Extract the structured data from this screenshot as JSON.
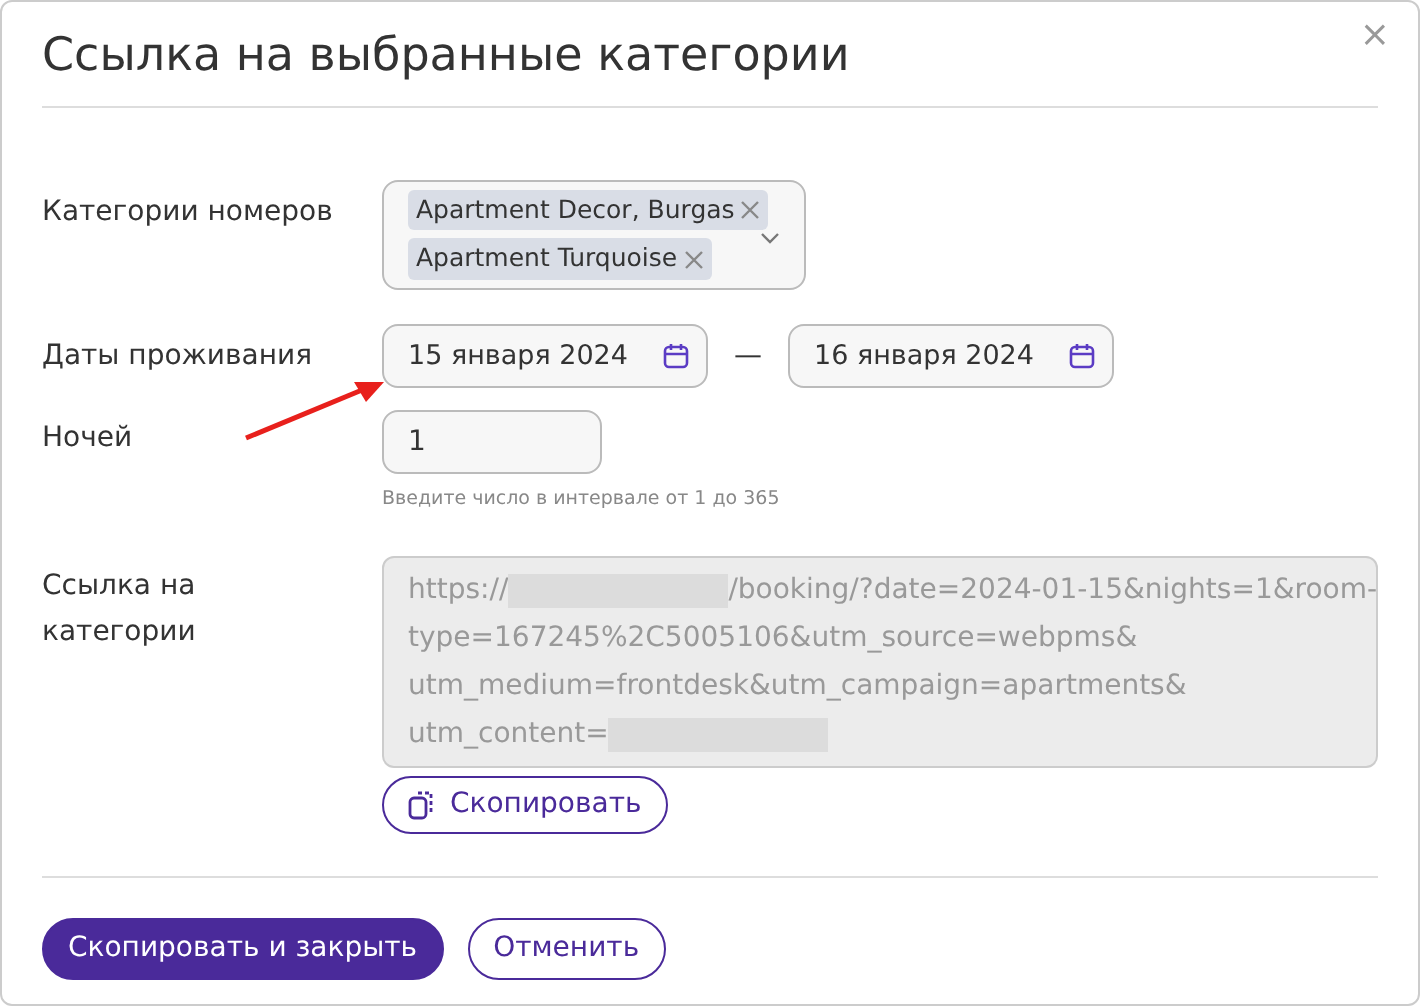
{
  "dialog": {
    "title": "Ссылка на выбранные категории",
    "close": "×"
  },
  "categories": {
    "label": "Категории номеров",
    "tags": [
      {
        "text": "Apartment Decor, Burgas"
      },
      {
        "text": "Apartment Turquoise"
      }
    ]
  },
  "dates": {
    "label": "Даты проживания",
    "from": "15 января 2024",
    "separator": "—",
    "to": "16 января 2024"
  },
  "nights": {
    "label": "Ночей",
    "value": "1",
    "hint": "Введите число в интервале от 1 до 365"
  },
  "link": {
    "label": "Ссылка на категории",
    "lines": [
      [
        {
          "kind": "text",
          "text": "https://"
        },
        {
          "kind": "redaction"
        },
        {
          "kind": "text",
          "text": "/booking/?date=2024-01-15&nights=1&room-"
        }
      ],
      [
        {
          "kind": "text",
          "text": "type=167245%2C5005106&utm_source=webpms&"
        }
      ],
      [
        {
          "kind": "text",
          "text": "utm_medium=frontdesk&utm_campaign=apartments&"
        }
      ],
      [
        {
          "kind": "text",
          "text": "utm_content="
        },
        {
          "kind": "redaction"
        }
      ]
    ],
    "copy_button": "Скопировать"
  },
  "footer": {
    "buttons": [
      {
        "kind": "primary",
        "text": "Скопировать и закрыть"
      },
      {
        "kind": "outline",
        "text": "Отменить"
      }
    ]
  }
}
